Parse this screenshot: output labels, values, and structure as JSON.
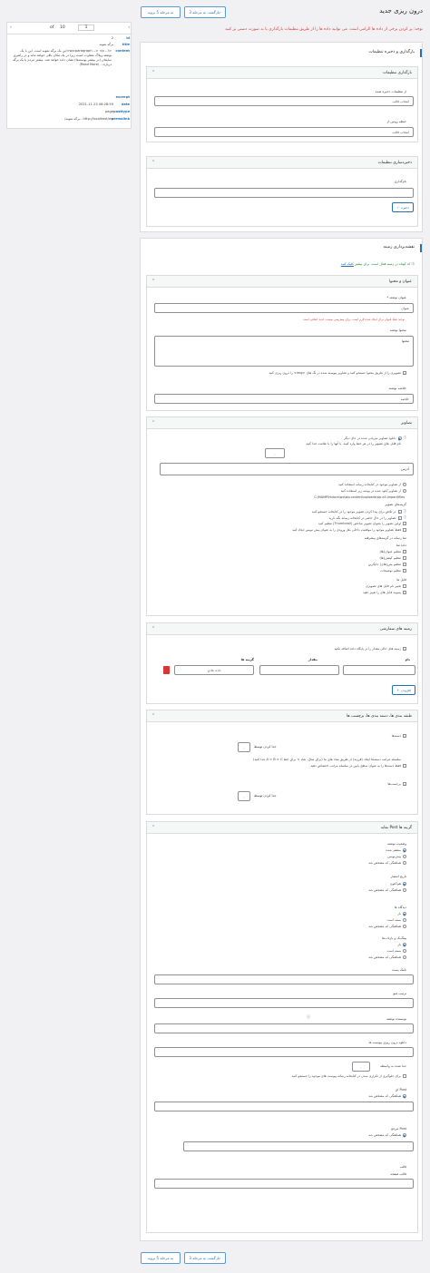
{
  "page": {
    "title": "درون ریزی جدید",
    "notice": "توجه: پر کردن برخی از داده ها الزامی است. می توانید داده ها را از طریق تنظیمات بارگذاری یا به صورت دستی پر کنید",
    "nav": {
      "back_label": "بازگشت به مرحله 3",
      "next_label": "به مرحله 5 بروید"
    }
  },
  "preview": {
    "current": "1",
    "of_label": "of",
    "total": "10",
    "fields": [
      {
        "key": "id",
        "value": "2"
      },
      {
        "key": "title",
        "value": "برگه نمونه"
      },
      {
        "key": "content",
        "value": "<!-- wp:paragraph --> <p>این یک برگه نمونه است. این با یک نوشته وبلاگ متفاوت است زیرا در یک مکان باقی خواهد ماند و در راهبری سایتتان (در بیشتر پوسته‌ها) نشان داده خواهد شد. بیشتر مردم با یک برگه درباره... (Read More)"
      },
      {
        "key": "excerpt",
        "value": ""
      },
      {
        "key": "date",
        "value": "06:28:59 2021-11-23"
      },
      {
        "key": "posttype",
        "value": "page"
      },
      {
        "key": "permalink",
        "value": "http://localhost/wo...برگه-نمونه/"
      }
    ]
  },
  "settings": {
    "title": "بارگذاری و ذخیره تنظیمات",
    "load": {
      "title": "بارگذاری تنظیمات",
      "saved_label": "از تنظیمات ذخیره شده",
      "saved_value": "انتخاب قالب",
      "template_label": "حیطه روتین از",
      "template_value": "انتخاب قالب"
    },
    "save": {
      "title": "ذخیره‌سازی تنظیمات",
      "name_label": "نام‌گذاری",
      "save_button": "ذخیره"
    }
  },
  "mapping": {
    "title": "نقشه‌برداری زمینه",
    "help_text": "کد کوتاه در زمینه فعال است. برای بیشتر",
    "help_link": "کلیک کنید",
    "title_content": {
      "title": "عنوان و محتوا",
      "post_title_label": "عنوان نوشته *",
      "post_title_ph": "عنوان",
      "required_note": "توجه: فیلد عنوان برای ایجاد شده لازم است. برای پیش‌بینی نوشت جدید اضافی است",
      "content_label": "محتوا نوشته",
      "content_ph": "محتوا",
      "img_option": "تصویری را از طریق محتوا جستجو کنید و تصاویر پیوسته شده در تگ های <img> را درون ریزی کنید",
      "excerpt_label": "خلاصه نوشته",
      "excerpt_ph": "خلاصه"
    },
    "images": {
      "title": "تصاویر",
      "opt_download": "دانلود تصاویر میزبانی شده در جای دیگر",
      "opt_download_sub": "نام فایل های تصویر را در هر خط وارد کنید. یا آنها را با علامت جدا کنید",
      "sep_value": ",",
      "images_ph": "آدرس",
      "opt_media": "از تصاویر موجود در کتابخانه رسانه استفاده کنید",
      "opt_server": "از تصاویر آپلود شده در پوشه زیر استفاده کنید",
      "server_path": "C:\\MAMP\\htdocs\\wo\\wp-content\\uploads\\wp-all-import\\files",
      "options_title": "گزینه‌های تصویر",
      "opt_search": "در تلاش برای پیدا کردن تصویر موجود را در کتابخانه جستجو کنید",
      "opt_keep": "تصاویر را در حال حاضر در کتابخانه رسانه نگه دارید",
      "opt_first": "اولین تصویر را بعنوان تصویر شاخص (Thumbnail) تنظیم کنید",
      "opt_meta": "فقط تصاویر موجود را موقعیت داخلی بغل ورودی را به عنوان پیش نویس ایجاد کنید",
      "meta_title": "متا رسانه در گزینه‌های پیشرفته",
      "meta_sub": "داده متا",
      "meta_title_opt": "تنظیم عنوان(ها)",
      "meta_caption_opt": "تنظیم کپشن(ها)",
      "meta_alt_opt": "تنظیم متن(های) جایگزین",
      "meta_desc_opt": "تنظیم توضیحات",
      "files_title": "فایل ها",
      "files_rename": "تغییر نام فایل های تصویری",
      "files_ext": "پسوند فایل های را تغییر دهید"
    },
    "custom_fields": {
      "title": "زمینه های سفارشی",
      "opt_auto": "زمینه های خالی مقدار را در پایگاه داده اضافه نکنید",
      "name_col": "نام",
      "value_col": "مقدار",
      "type_col": "گزینه ها",
      "type_value": "داده عادی",
      "add_button": "افزودن"
    },
    "taxonomies": {
      "title": "طبقه بندی ها، دسته بندی ها، برچسب ها",
      "cat_label": "دسته‌ها",
      "cat_sep_label": "جدا کردن توسط",
      "cat_sep_value": ",",
      "cat_hint": "سلسله مراتب دسته‌ها ایجاد (فرزند) از طریق نماد های ما (برای مثال، نماد > برای خط A > B > C جدا کنید)",
      "cat_hint2": "فقط دسته‌ها را به عنوان سطح پایین در سلسله مراتب اختصاص دهید",
      "tag_label": "برچسب‌ها",
      "tag_sep_label": "جدا کردن توسط",
      "tag_sep_value": ","
    },
    "other": {
      "title": "گزینه ها Post نمایه",
      "status_title": "وضعیت نوشته",
      "status_published": "منتشر شده",
      "status_draft": "پیش‌نویس",
      "status_xpath": "هماهنگی که مشخص شد",
      "date_title": "تاریخ انتشار",
      "date_now": "هم‌اکنون",
      "date_xpath": "هماهنگی که مشخص شد",
      "comments_title": "دیدگاه ها",
      "comments_open": "باز",
      "comments_closed": "بسته است",
      "comments_xpath": "هماهنگی که مشخص شد",
      "ping_title": "پینگ‌بک و بازتاب‌ها",
      "ping_open": "باز",
      "ping_closed": "بسته است",
      "ping_xpath": "هماهنگی که مشخص شد",
      "slug_label": "نامک پست",
      "menu_order_label": "ترتیب منو",
      "author_label": "نویسنده نوشته",
      "download_label": "دانلود درون ریزی پیوست ها",
      "attach_sep_label": "جدا شده به واسطه",
      "attach_sep_value": ",",
      "attach_search": "برای جلوگیری از تکراری شدن در کتابخانه رسانه پیوست های موجود را جستجو کنید",
      "post_title": "Post ای",
      "post_xpath": "هماهنگی که مشخص شد",
      "parent_title": "Post مرجع",
      "parent_xpath": "هماهنگی که مشخص شد",
      "template_label": "قالب",
      "template_label2": "قالب صفحه"
    }
  },
  "watermark": "ادغام‌ها",
  "colors": {
    "accent": "#2271b1",
    "danger": "#d63638",
    "link": "#2271b1"
  }
}
